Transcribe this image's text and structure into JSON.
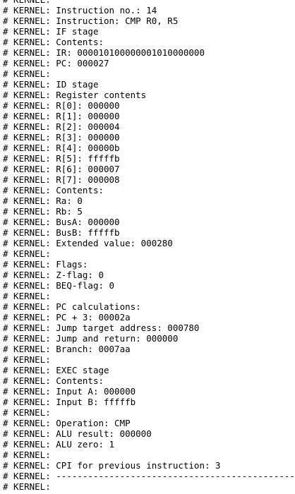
{
  "console": {
    "prefix": "# KERNEL:",
    "lines": [
      "",
      "Instruction no.: 14",
      "Instruction: CMP R0, R5",
      "IF stage",
      "Contents:",
      "IR: 000010100000001010000000",
      "PC: 000027",
      "",
      "ID stage",
      "Register contents",
      "R[0]: 000000",
      "R[1]: 000000",
      "R[2]: 000004",
      "R[3]: 000000",
      "R[4]: 00000b",
      "R[5]: fffffb",
      "R[6]: 000007",
      "R[7]: 000008",
      "Contents:",
      "Ra: 0",
      "Rb: 5",
      "BusA: 000000",
      "BusB: fffffb",
      "Extended value: 000280",
      "",
      "Flags:",
      "Z-flag: 0",
      "BEQ-flag: 0",
      "",
      "PC calculations:",
      "PC + 3: 00002a",
      "Jump target address: 000780",
      "Jump and return: 000000",
      "Branch: 0007aa",
      "",
      "EXEC stage",
      "Contents:",
      "Input A: 000000",
      "Input B: fffffb",
      "",
      "Operation: CMP",
      "ALU result: 000000",
      "ALU zero: 1",
      "",
      "CPI for previous instruction: 3",
      "------------------------------------------------",
      ""
    ]
  }
}
